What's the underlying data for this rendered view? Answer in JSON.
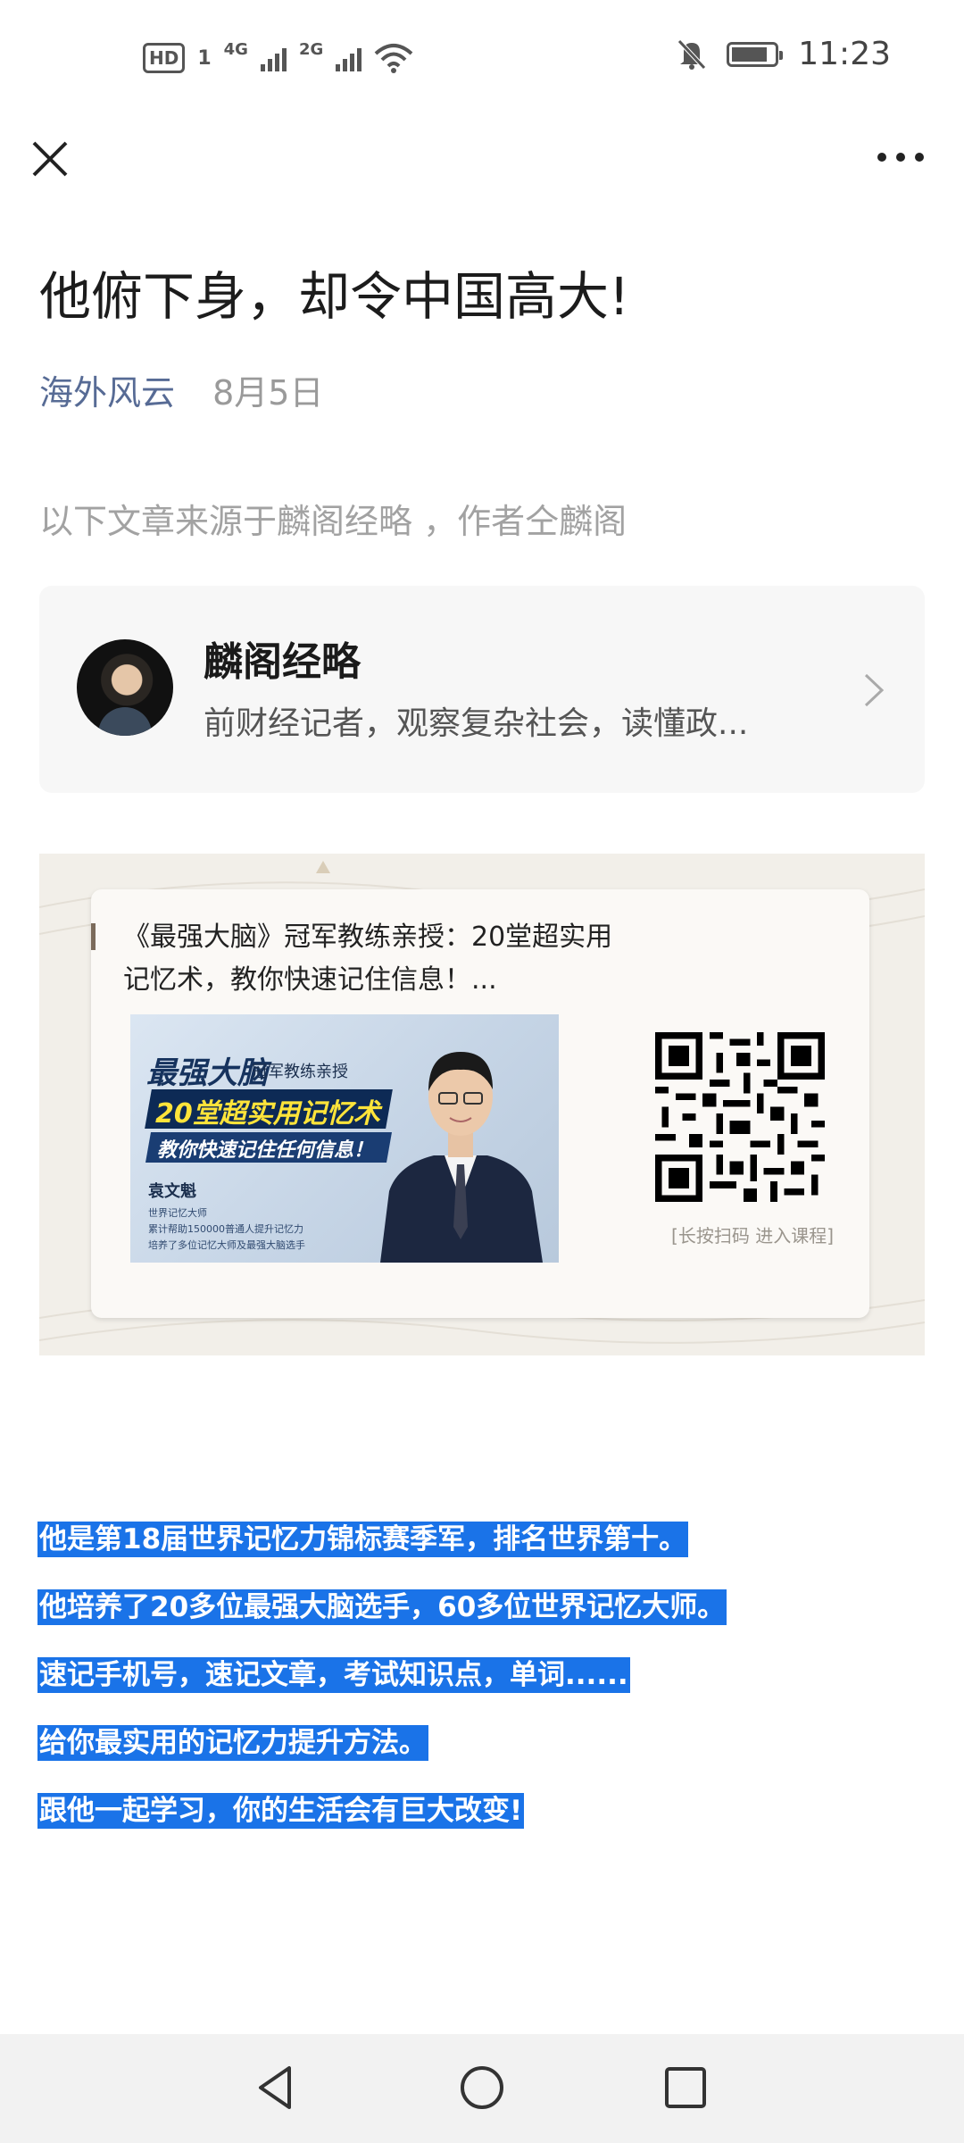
{
  "status_bar": {
    "hd": "HD",
    "sim": "1",
    "net1": "4G",
    "net2": "2G",
    "time": "11:23",
    "battery_level": 0.85,
    "icons": [
      "signal-icon",
      "wifi-icon",
      "mute-icon",
      "battery-icon"
    ]
  },
  "nav": {
    "close_icon": "close-icon",
    "more_icon": "more-icon"
  },
  "article": {
    "title": "他俯下身，却令中国高大!",
    "account": "海外风云",
    "date": "8月5日",
    "source_note": "以下文章来源于麟阁经略 ，作者仝麟阁"
  },
  "profile": {
    "name": "麟阁经略",
    "desc": "前财经记者，观察复杂社会，读懂政..."
  },
  "promo": {
    "title": "《最强大脑》冠军教练亲授：20堂超实用记忆术，教你快速记住信息！...",
    "image": {
      "brand": "最强大脑",
      "sub": "冠军教练亲授",
      "headline": "20堂超实用记忆术",
      "subline": "教你快速记住任何信息！",
      "person_name": "袁文魁",
      "lines": [
        "世界记忆大师",
        "累计帮助150000普通人提升记忆力",
        "培养了多位记忆大师及最强大脑选手"
      ]
    },
    "qr_caption": "[长按扫码  进入课程]"
  },
  "highlights": [
    "他是第18届世界记忆力锦标赛季军，排名世界第十。",
    "他培养了20多位最强大脑选手，60多位世界记忆大师。",
    "速记手机号，速记文章，考试知识点，单词......",
    "给你最实用的记忆力提升方法。",
    "跟他一起学习，你的生活会有巨大改变!"
  ],
  "navbar": {
    "back_icon": "back-icon",
    "home_icon": "home-icon",
    "recents_icon": "recents-icon"
  }
}
